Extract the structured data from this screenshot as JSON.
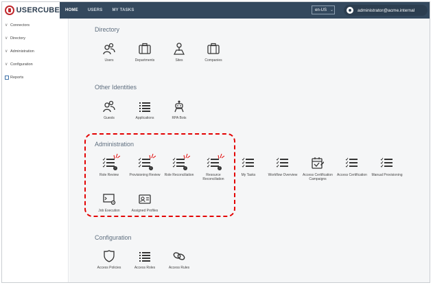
{
  "logo": {
    "text": "USERCUBE"
  },
  "nav": {
    "items": [
      "HOME",
      "USERS",
      "MY TASKS"
    ]
  },
  "language": {
    "value": "en-US"
  },
  "user": {
    "name": "administrator@acme.internal"
  },
  "sidebar": {
    "items": [
      {
        "label": "Connectors",
        "icon": "chevron-down-icon"
      },
      {
        "label": "Directory",
        "icon": "chevron-down-icon"
      },
      {
        "label": "Administration",
        "icon": "chevron-down-icon"
      },
      {
        "label": "Configuration",
        "icon": "chevron-down-icon"
      },
      {
        "label": "Reports",
        "icon": "report-icon"
      }
    ]
  },
  "sections": {
    "directory": {
      "title": "Directory",
      "tiles": [
        "Users",
        "Departments",
        "Sites",
        "Companies"
      ]
    },
    "other": {
      "title": "Other Identities",
      "tiles": [
        "Guests",
        "Applications",
        "RPA Bots"
      ]
    },
    "administration": {
      "title": "Administration",
      "tiles": [
        {
          "label": "Role Review",
          "icon": "list-check-icon",
          "badge": "!"
        },
        {
          "label": "Provisioning Review",
          "icon": "list-check-icon",
          "badge": "!"
        },
        {
          "label": "Role Reconciliation",
          "icon": "list-check-icon",
          "badge": "!"
        },
        {
          "label": "Resource Reconciliation",
          "icon": "list-check-icon",
          "badge": "!"
        },
        {
          "label": "My Tasks",
          "icon": "list-check-icon"
        },
        {
          "label": "Workflow Overview",
          "icon": "list-check-icon"
        },
        {
          "label": "Access Certification Campaigns",
          "icon": "calendar-check-icon"
        },
        {
          "label": "Access Certification",
          "icon": "list-check-icon"
        },
        {
          "label": "Manual Provisioning",
          "icon": "list-check-icon"
        },
        {
          "label": "Job Execution",
          "icon": "monitor-gear-icon"
        },
        {
          "label": "Assigned Profiles",
          "icon": "id-card-icon"
        }
      ]
    },
    "configuration": {
      "title": "Configuration",
      "tiles": [
        "Access Policies",
        "Access Roles",
        "Access Rules"
      ]
    }
  },
  "colors": {
    "topbar": "#34495e",
    "highlight": "#e30000",
    "logo_red": "#c0282d"
  }
}
